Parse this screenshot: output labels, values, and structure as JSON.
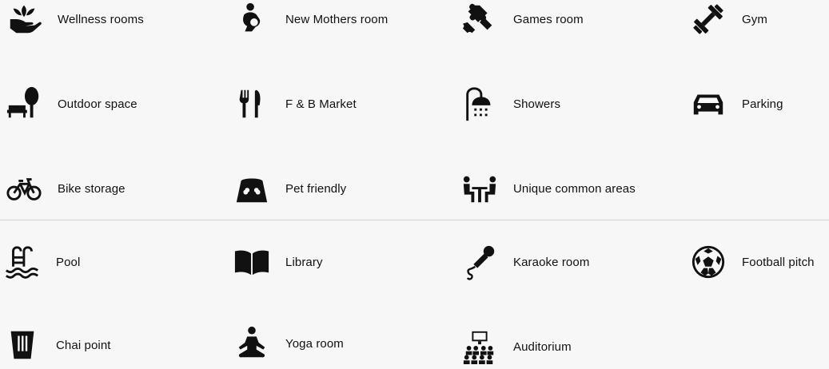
{
  "amenities": {
    "section_1": [
      {
        "label": "Wellness rooms",
        "icon": "lotus-hand-icon"
      },
      {
        "label": "New Mothers room",
        "icon": "mother-baby-icon"
      },
      {
        "label": "Games room",
        "icon": "puzzle-icon"
      },
      {
        "label": "Gym",
        "icon": "dumbbell-icon"
      },
      {
        "label": "Outdoor space",
        "icon": "bench-tree-icon"
      },
      {
        "label": "F & B Market",
        "icon": "fork-knife-icon"
      },
      {
        "label": "Showers",
        "icon": "shower-icon"
      },
      {
        "label": "Parking",
        "icon": "car-icon"
      },
      {
        "label": "Bike storage",
        "icon": "bicycle-icon"
      },
      {
        "label": "Pet friendly",
        "icon": "pet-bowl-icon"
      },
      {
        "label": "Unique common areas",
        "icon": "people-table-icon"
      }
    ],
    "section_2": [
      {
        "label": "Pool",
        "icon": "pool-icon"
      },
      {
        "label": "Library",
        "icon": "book-icon"
      },
      {
        "label": "Karaoke room",
        "icon": "microphone-icon"
      },
      {
        "label": "Football pitch",
        "icon": "football-icon"
      },
      {
        "label": "Chai point",
        "icon": "cup-icon"
      },
      {
        "label": "Yoga room",
        "icon": "yoga-icon"
      },
      {
        "label": "Auditorium",
        "icon": "auditorium-icon"
      }
    ]
  }
}
